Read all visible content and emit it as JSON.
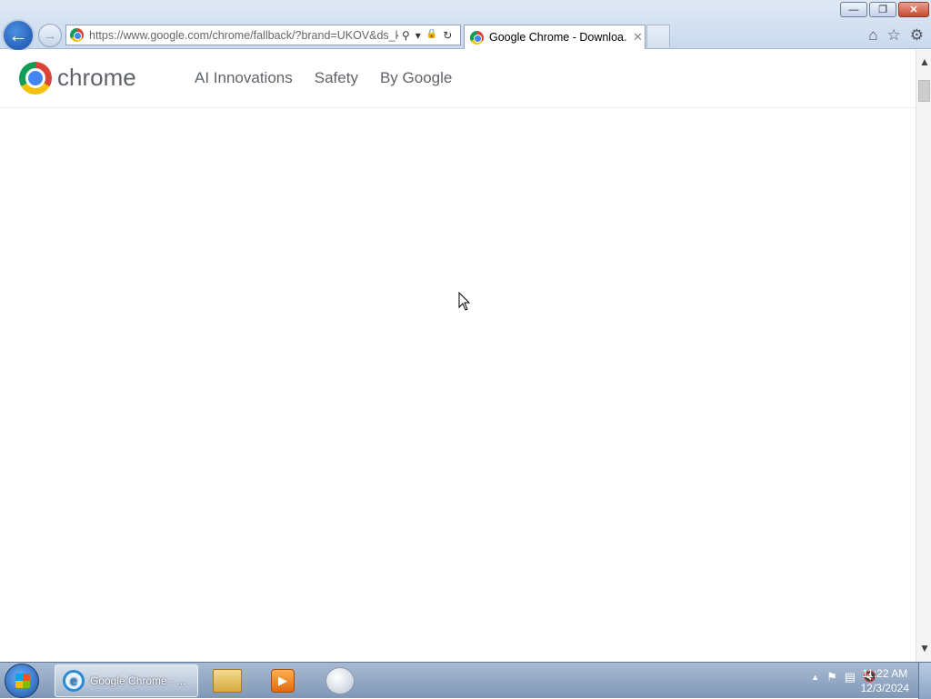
{
  "browser": {
    "address_url": "https://www.google.com/chrome/fallback/?brand=UKOV&ds_k",
    "tab_title": "Google Chrome - Downloa...",
    "tab_close": "✕",
    "back": "←",
    "forward": "→",
    "window": {
      "minimize": "—",
      "restore": "❐",
      "close": "✕"
    },
    "toolbar_icons": {
      "home": "⌂",
      "favorites": "☆",
      "settings": "⚙"
    },
    "address_icons": {
      "search": "⚲",
      "dropdown": "▾",
      "lock": "🔒",
      "refresh": "↻"
    }
  },
  "site": {
    "logo_text": "chrome",
    "nav": [
      "AI Innovations",
      "Safety",
      "By Google"
    ]
  },
  "scrollbar": {
    "up": "▲",
    "down": "▼"
  },
  "taskbar": {
    "ie_label": "Google Chrome - ...",
    "ie_icon": "e",
    "media_icon": "▶",
    "tray": {
      "expand": "▲",
      "flag": "⚑",
      "network": "▤",
      "volume": "🔇"
    },
    "clock_time": "11:22 AM",
    "clock_date": "12/3/2024"
  }
}
